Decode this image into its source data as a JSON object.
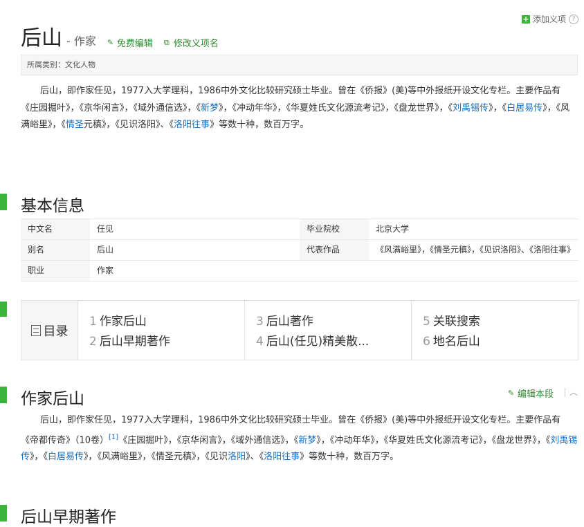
{
  "header": {
    "add_item": "添加义项",
    "title": "后山",
    "subtitle": "- 作家",
    "edit_link": "免费编辑",
    "rename_link": "修改义项名",
    "category": "所属类别：文化人物"
  },
  "intro": {
    "t1": "后山，即作家任见，1977入大学理科，1986中外文化比较研究硕士毕业。曾在《侨报》(美)等中外报纸开设文化专栏。主要作品有《庄园掘叶》，《京华闲言》，《域外通信选》，《",
    "l1": "新梦",
    "t2": "》，《冲动年华》，《华夏姓氏文化源流考记》，《盘龙世界》，《",
    "l2": "刘禹锡传",
    "t3": "》，《",
    "l3": "白居易传",
    "t4": "》，《风满峪里》，《",
    "l4": "情圣",
    "t5": "元稹》，《见识洛阳》、《",
    "l5": "洛阳往事",
    "t6": "》等数十种，数百万字。"
  },
  "basic_info": {
    "heading": "基本信息",
    "rows": [
      {
        "k1": "中文名",
        "v1": "任见",
        "k2": "毕业院校",
        "v2": "北京大学"
      },
      {
        "k1": "别名",
        "v1": "后山",
        "k2": "代表作品",
        "v2": "《风满峪里》，《情圣元稹》，《见识洛阳》、《洛阳往事》"
      },
      {
        "k1": "职业",
        "v1": "作家",
        "k2": "",
        "v2": ""
      }
    ]
  },
  "catalog": {
    "label": "目录",
    "items": [
      {
        "n": "1",
        "t": "作家后山"
      },
      {
        "n": "2",
        "t": "后山早期著作"
      },
      {
        "n": "3",
        "t": "后山著作"
      },
      {
        "n": "4",
        "t": "后山(任见)精美散..."
      },
      {
        "n": "5",
        "t": "关联搜索"
      },
      {
        "n": "6",
        "t": "地名后山"
      }
    ]
  },
  "section1": {
    "heading": "作家后山",
    "edit": "编辑本段",
    "t1": "后山，即作家任见，1977入大学理科，1986中外文化比较研究硕士毕业。曾在《侨报》(美)等中外报纸开设文化专栏。主要作品有《帝都传奇》（10卷）",
    "sup": "[1]",
    "t2": "《庄园掘叶》，《京华闲言》，《域外通信选》，《",
    "l1": "新梦",
    "t3": "》，《冲动年华》，《华夏姓氏文化源流考记》，《盘龙世界》，《",
    "l2": "刘禹锡传",
    "t4": "》，《",
    "l3": "白居易传",
    "t5": "》，《风满峪里》，《情圣元稹》，《见识",
    "l4": "洛阳",
    "t6": "》、《",
    "l5": "洛阳往事",
    "t7": "》等数十种，数百万字。"
  },
  "section2": {
    "heading": "后山早期著作"
  }
}
